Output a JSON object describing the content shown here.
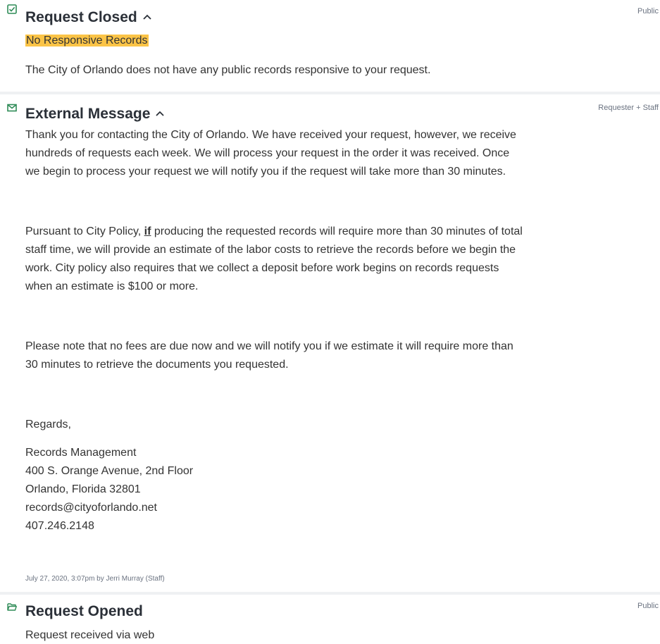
{
  "closed": {
    "title": "Request Closed",
    "visibility": "Public",
    "status_badge": "No Responsive Records",
    "message": "The City of Orlando does not have any public records responsive to your request."
  },
  "external": {
    "title": "External Message",
    "visibility": "Requester + Staff",
    "p1": [
      "Thank you for contacting the City of Orlando.  We have received your request, however, we receive",
      "hundreds of requests each week.  We will process your request in the order it was received.  Once",
      "we begin to process your request we will notify you if the request will take more than 30 minutes."
    ],
    "p2_prefix": "Pursuant to City Policy, ",
    "p2_emph": "if",
    "p2_suffix": " producing the requested records will require more than 30 minutes of total",
    "p2_rest": [
      "staff time, we will provide an estimate of the labor costs to retrieve the records before we begin the",
      "work. City policy also requires that we collect a deposit before work begins on records requests",
      "when an estimate is $100 or more."
    ],
    "p3": [
      "Please note that no fees are due now and we will notify you if we estimate it will require more than",
      "30 minutes to retrieve the documents you requested."
    ],
    "regards": "Regards,",
    "signature": [
      "Records Management",
      "400 S. Orange Avenue, 2nd Floor",
      "Orlando, Florida 32801",
      "records@cityoforlando.net",
      "407.246.2148"
    ],
    "meta": "July 27, 2020, 3:07pm by Jerri Murray (Staff)"
  },
  "opened": {
    "title": "Request Opened",
    "visibility": "Public",
    "message": "Request received via web"
  },
  "colors": {
    "icon_green": "#2e8b57",
    "highlight": "#fbc447",
    "separator": "#eff1f3"
  },
  "icons": {
    "closed": "checkbox-icon",
    "external": "envelope-icon",
    "opened": "folder-open-icon",
    "collapse": "chevron-up-icon"
  }
}
